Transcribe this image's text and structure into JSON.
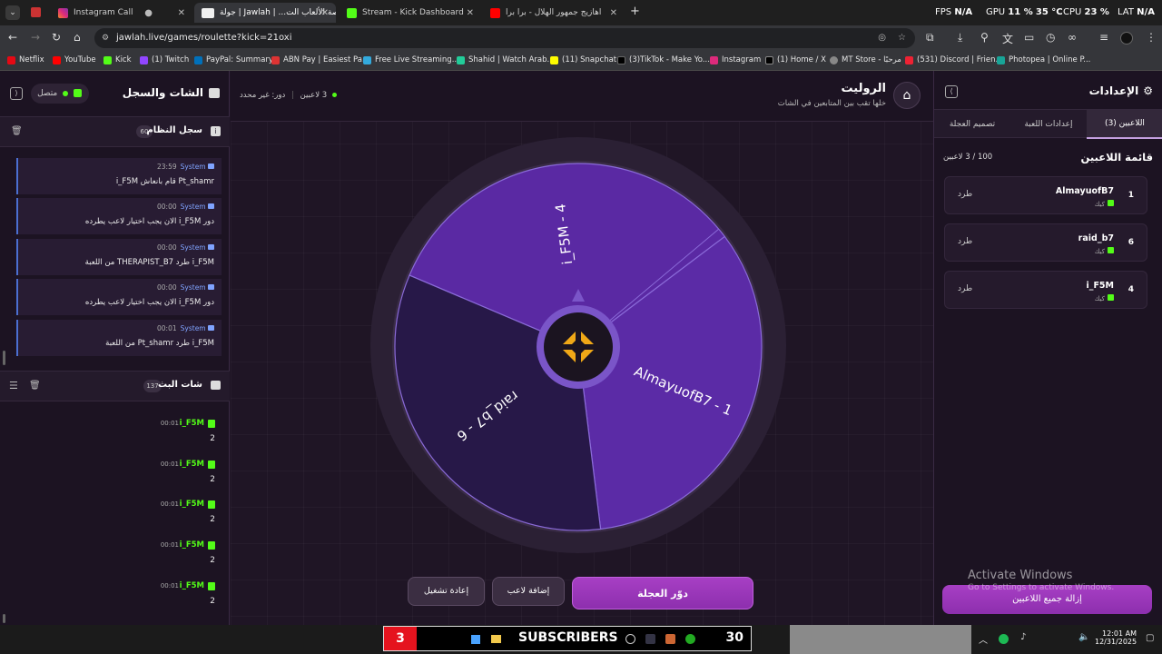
{
  "browser": {
    "tabs": [
      {
        "label": "Instagram Call",
        "active": false
      },
      {
        "label": "منصة الألعاب الت... | Jawlah | جولة",
        "active": true
      },
      {
        "label": "Stream - Kick Dashboard",
        "active": false
      },
      {
        "label": "اهازيج جمهور الهلال - برا برا",
        "active": false
      }
    ],
    "perf": {
      "fps_label": "FPS",
      "fps_value": "N/A",
      "gpu_label": "GPU",
      "gpu_value": "11 %",
      "gpu_temp": "35 °C",
      "cpu_label": "CPU",
      "cpu_value": "23 %",
      "lat_label": "LAT",
      "lat_value": "N/A"
    },
    "url": "jawlah.live/games/roulette?kick=21oxi",
    "bookmarks": [
      "Netflix",
      "YouTube",
      "Kick",
      "(1) Twitch",
      "PayPal: Summary",
      "ABN Pay | Easiest Pa...",
      "Free Live Streaming...",
      "Shahid | Watch Arab...",
      "(11) Snapchat",
      "(3)TikTok - Make Yo...",
      "Instagram",
      "(1) Home / X",
      "MT Store - مرحبًا",
      "(531) Discord | Frien...",
      "Photopea | Online P..."
    ]
  },
  "left_panel": {
    "title": "الشات والسجل",
    "status": "متصل",
    "system_log": {
      "title": "سجل النظام",
      "count": "60"
    },
    "system_messages": [
      {
        "sender": "System",
        "time": "23:59",
        "text": "Pt_shamr قام بانعاش i_F5M"
      },
      {
        "sender": "System",
        "time": "00:00",
        "text": "دور i_F5M الان يجب اختيار لاعب يطرده"
      },
      {
        "sender": "System",
        "time": "00:00",
        "text": "i_F5M طرد THERAPIST_B7 من اللعبة"
      },
      {
        "sender": "System",
        "time": "00:00",
        "text": "دور i_F5M الان يجب اختيار لاعب يطرده"
      },
      {
        "sender": "System",
        "time": "00:01",
        "text": "i_F5M طرد Pt_shamr من اللعبة"
      }
    ],
    "stream_chat": {
      "title": "شات البث",
      "count": "137"
    },
    "stream_messages": [
      {
        "user": "i_F5M",
        "time": "00:01",
        "text": "2"
      },
      {
        "user": "i_F5M",
        "time": "00:01",
        "text": "2"
      },
      {
        "user": "i_F5M",
        "time": "00:01",
        "text": "2"
      },
      {
        "user": "i_F5M",
        "time": "00:01",
        "text": "2"
      },
      {
        "user": "i_F5M",
        "time": "00:01",
        "text": "2"
      }
    ]
  },
  "center": {
    "title": "الروليت",
    "subtitle": "خلها تقب بين المتابعين في الشات",
    "players_count": "3 لاعبين",
    "turn": "دور: غير محدد",
    "wheel_segments": [
      {
        "label": "i_F5M - 4",
        "color": "#5a29a3"
      },
      {
        "label": "AlmayuofB7 - 1",
        "color": "#5b2ba6"
      },
      {
        "label": "raid_b7 - 6",
        "color": "#271848"
      }
    ],
    "buttons": {
      "spin": "دوّر العجلة",
      "add_player": "إضافة لاعب",
      "restart": "إعادة تشغيل"
    }
  },
  "right_panel": {
    "title": "الإعدادات",
    "tabs": [
      "اللاعبين (3)",
      "إعدادات اللعبة",
      "تصميم العجلة"
    ],
    "list_title": "قائمة اللاعبين",
    "list_count": "100 / 3 لاعبين",
    "kick_label": "كيك",
    "kick_action": "طرد",
    "players": [
      {
        "number": "1",
        "name": "AlmayuofB7"
      },
      {
        "number": "6",
        "name": "raid_b7"
      },
      {
        "number": "4",
        "name": "i_F5M"
      }
    ],
    "remove_all": "إزالة جميع اللاعبين",
    "watermark_title": "Activate Windows",
    "watermark_sub": "Go to Settings to activate Windows."
  },
  "taskbar": {
    "widget_number": "3",
    "widget_text": "SUBSCRIBERS",
    "widget_count": "30",
    "time": "12:01 AM",
    "date": "12/31/2025"
  },
  "colors": {
    "accent": "#a73fc4",
    "kick_green": "#53fc18",
    "bg": "#1e1424"
  }
}
